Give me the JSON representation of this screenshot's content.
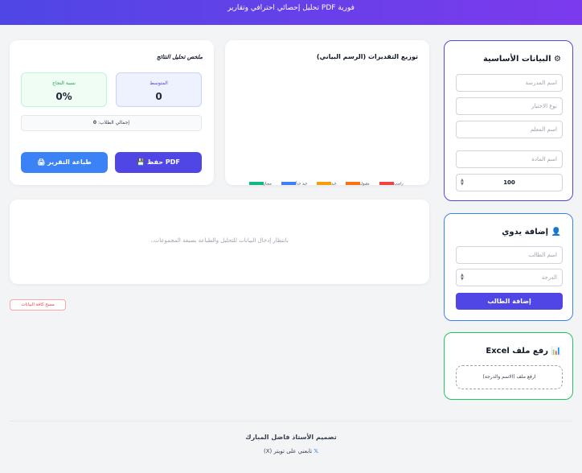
{
  "header": {
    "subtitle": "تحليل إحصائي احترافي وتقارير PDF فورية"
  },
  "basic_info": {
    "title": "البيانات الأساسية",
    "school_placeholder": "اسم المدرسة",
    "exam_type_placeholder": "نوع الاختبار",
    "teacher_placeholder": "اسم المعلم",
    "subject_placeholder": "اسم المادة",
    "max_score_value": "100"
  },
  "manual_add": {
    "title": "إضافة يدوي",
    "student_name_placeholder": "اسم الطالب",
    "score_placeholder": "الدرجة",
    "add_button_label": "إضافة الطالب"
  },
  "excel_upload": {
    "title": "رفع ملف Excel",
    "dropzone_text": "ارفع ملف (الاسم والدرجة)"
  },
  "chart": {
    "title": "توزيع التقديرات (الرسم البياني)",
    "legend": [
      {
        "label": "راسب",
        "color": "#ef4444"
      },
      {
        "label": "مقبول",
        "color": "#f97316"
      },
      {
        "label": "جيد",
        "color": "#f59e0b"
      },
      {
        "label": "جيد جداً",
        "color": "#3b82f6"
      },
      {
        "label": "ممتاز",
        "color": "#10b981"
      }
    ]
  },
  "summary": {
    "title": "ملخص تحليل النتائج",
    "average_label": "المتوسط",
    "average_value": "0",
    "pass_rate_label": "نسبة النجاح",
    "pass_rate_value": "0%",
    "total_label": "إجمالي الطلاب:",
    "total_value": "0",
    "save_pdf_label": "حفظ PDF",
    "print_label": "طباعة التقرير"
  },
  "groups_panel": {
    "message": "بانتظار إدخال البيانات للتحليل والطباعة بصيغة المجموعات.."
  },
  "clear_button_label": "مسح كافة البيانات",
  "footer": {
    "credit": "تصميم الأستاذ فاضل المبارك",
    "follow": "تابعني على تويتر (X)"
  }
}
